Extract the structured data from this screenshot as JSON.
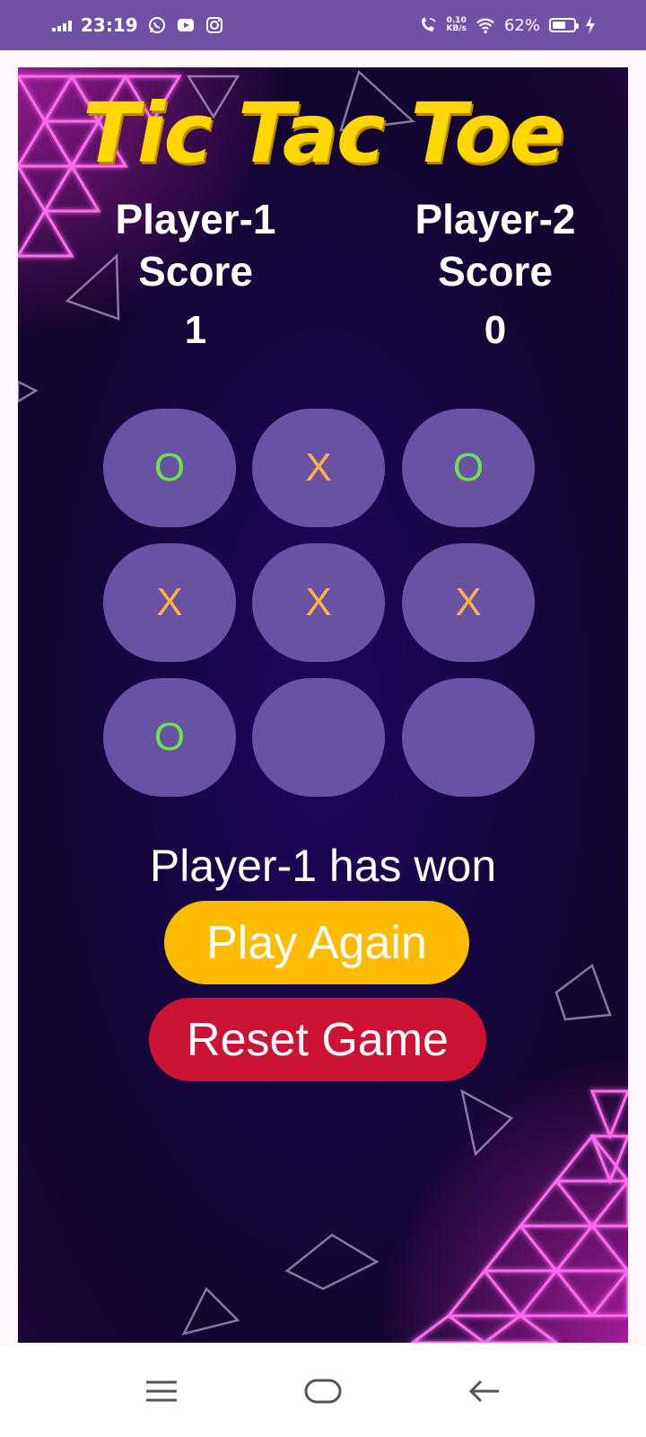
{
  "status_bar": {
    "time": "23:19",
    "net_speed_value": "0.10",
    "net_speed_unit": "KB/s",
    "battery_percent": "62%",
    "battery_level": 0.62
  },
  "game": {
    "title": "Tic Tac Toe",
    "player1": {
      "label_line1": "Player-1",
      "label_line2": "Score",
      "score": "1"
    },
    "player2": {
      "label_line1": "Player-2",
      "label_line2": "Score",
      "score": "0"
    },
    "board": [
      [
        "O",
        "X",
        "O"
      ],
      [
        "X",
        "X",
        "X"
      ],
      [
        "O",
        "",
        ""
      ]
    ],
    "status_message": "Player-1 has won",
    "play_again_label": "Play Again",
    "reset_label": "Reset Game"
  },
  "colors": {
    "title": "#ffd700",
    "cell": "#6951a3",
    "o_mark": "#6ce34a",
    "x_mark": "#ffb23f",
    "play_again": "#ffbb00",
    "reset": "#cd1333",
    "status_bar": "#6f52a6"
  },
  "icons": {
    "status_left": [
      "signal-icon",
      "whatsapp-icon",
      "youtube-icon",
      "instagram-icon"
    ],
    "status_right": [
      "wifi-calling-icon",
      "wifi-icon",
      "battery-icon",
      "charging-icon"
    ],
    "navigation": [
      "menu-icon",
      "home-icon",
      "back-icon"
    ]
  }
}
